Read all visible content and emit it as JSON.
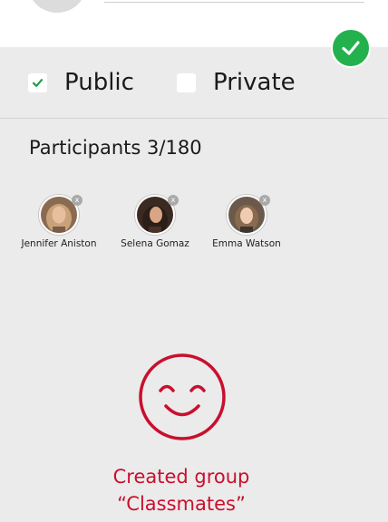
{
  "privacy": {
    "public_label": "Public",
    "private_label": "Private",
    "public_checked": true,
    "private_checked": false
  },
  "participants": {
    "heading": "Participants 3/180",
    "list": [
      {
        "name": "Jennifer Aniston",
        "remove": "x"
      },
      {
        "name": "Selena Gomaz",
        "remove": "x"
      },
      {
        "name": "Emma Watson",
        "remove": "x"
      }
    ]
  },
  "status": {
    "line1": "Created group",
    "line2": "“Classmates”",
    "icon": "smiley-face-icon"
  },
  "colors": {
    "accent_green": "#23b14d",
    "status_red": "#c8102e",
    "background": "#ebebeb"
  }
}
